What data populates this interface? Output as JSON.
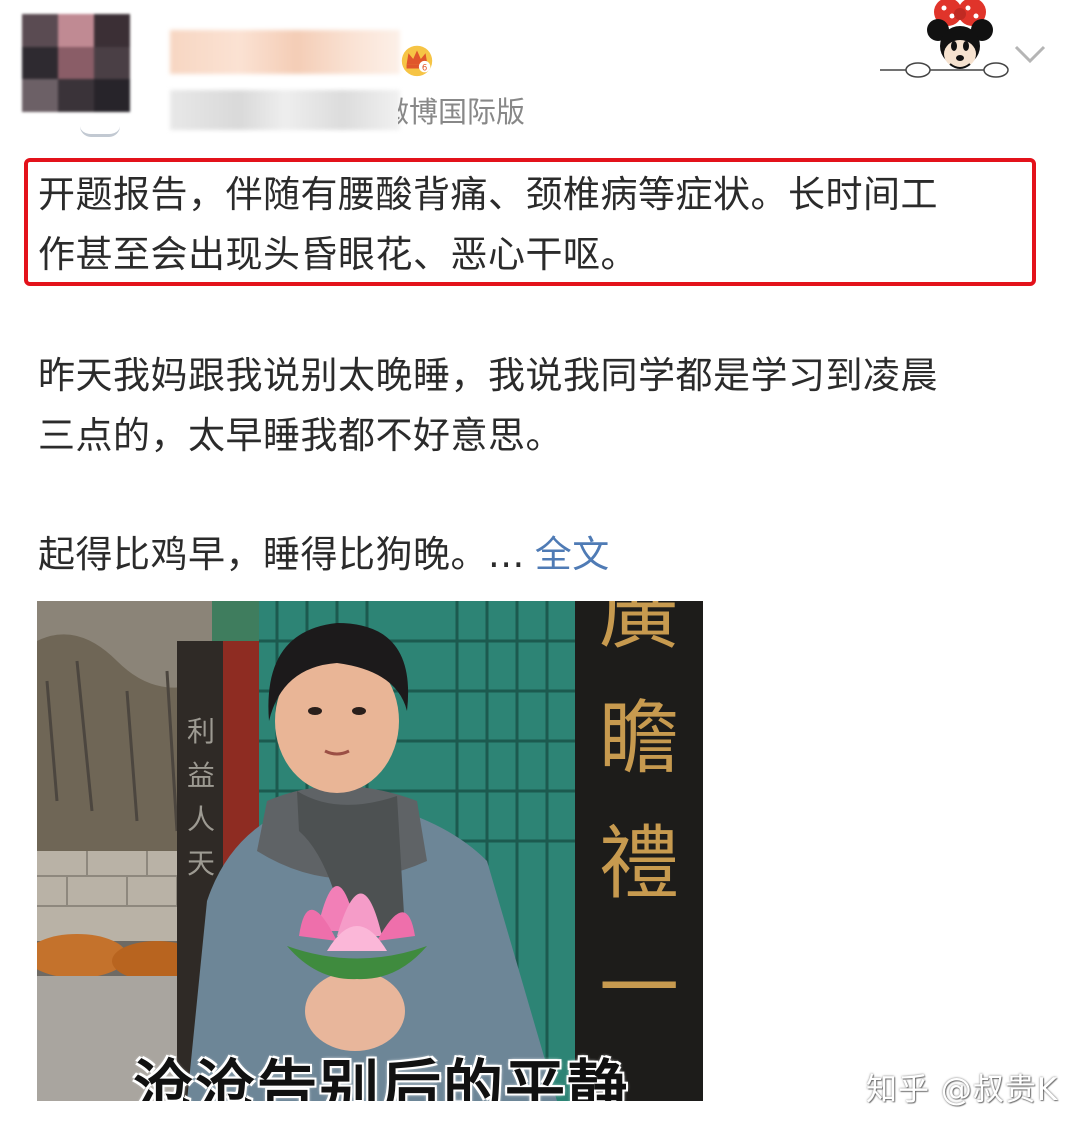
{
  "header": {
    "source_label": "微博国际版",
    "crown_color": "#f2b233",
    "avatar_colors": [
      "#5a4b52",
      "#c08a93",
      "#3b2f35",
      "#2e2a30",
      "#8a5d67",
      "#4a3f45",
      "#6c6066",
      "#3a3339",
      "#27242a"
    ]
  },
  "post": {
    "highlighted_lines": [
      "开题报告，伴随有腰酸背痛、颈椎病等症状。长时间工",
      "作甚至会出现头昏眼花、恶心干呕。"
    ],
    "paragraph2_lines": [
      "昨天我妈跟我说别太晚睡，我说我同学都是学习到凌晨",
      "三点的，太早睡我都不好意思。"
    ],
    "paragraph3_text": "起得比鸡早，睡得比狗晚。...",
    "full_text_link": "全文",
    "highlight_color": "#e3121b",
    "link_color": "#4f7bb5"
  },
  "image": {
    "caption": "沧沧告别后的平静",
    "sign_chars": [
      "廣",
      "瞻",
      "禮",
      "一"
    ],
    "pillar_chars": [
      "利",
      "益",
      "人",
      "天"
    ]
  },
  "watermark": "知乎 @叔贵K"
}
